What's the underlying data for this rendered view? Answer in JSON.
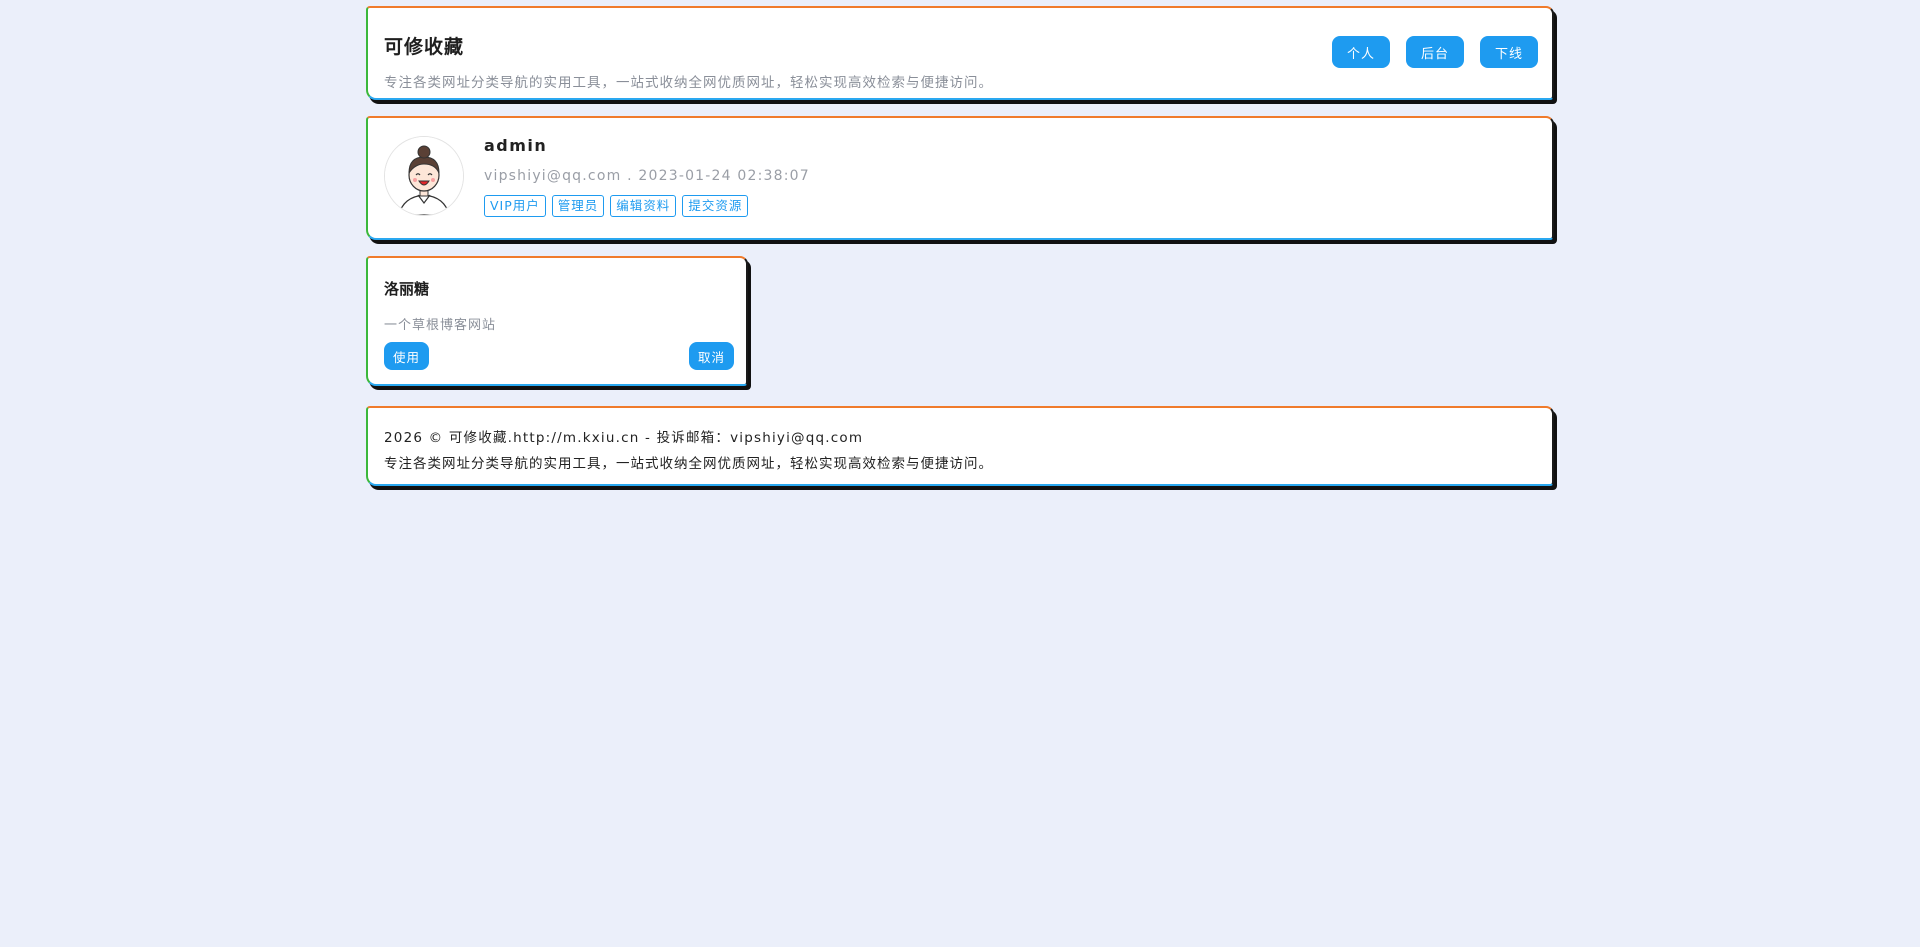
{
  "header": {
    "title": "可修收藏",
    "description": "专注各类网址分类导航的实用工具，一站式收纳全网优质网址，轻松实现高效检索与便捷访问。",
    "buttons": {
      "personal": "个人",
      "backend": "后台",
      "logout": "下线"
    }
  },
  "profile": {
    "avatar_icon": "cartoon-girl-avatar",
    "username": "admin",
    "email": "vipshiyi@qq.com",
    "separator": ".",
    "registered_at": "2023-01-24 02:38:07",
    "tags": [
      "VIP用户",
      "管理员",
      "编辑资料",
      "提交资源"
    ]
  },
  "site_card": {
    "title": "洛丽糖",
    "description": "一个草根博客网站",
    "use_label": "使用",
    "cancel_label": "取消"
  },
  "footer": {
    "line1": "2026 © 可修收藏.http://m.kxiu.cn - 投诉邮箱：vipshiyi@qq.com",
    "line2": "专注各类网址分类导航的实用工具，一站式收纳全网优质网址，轻松实现高效检索与便捷访问。"
  },
  "colors": {
    "accent": "#1e9bf0",
    "background": "#ebeffa",
    "border_top": "#f07b2b",
    "border_left": "#3bb83b",
    "border_bottom": "#2aa8f0"
  }
}
